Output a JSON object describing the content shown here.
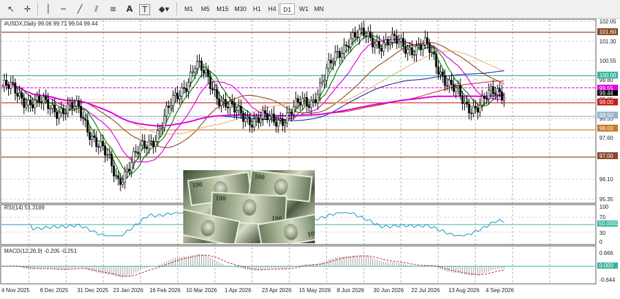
{
  "toolbar": {
    "icons": [
      "cursor-icon",
      "crosshair-icon",
      "vertical-line-icon",
      "horizontal-line-icon",
      "trendline-icon",
      "equidistant-channel-icon",
      "fibonacci-icon",
      "text-icon",
      "text-label-icon",
      "shapes-icon"
    ],
    "timeframes": [
      "M1",
      "M5",
      "M15",
      "M30",
      "H1",
      "H4",
      "D1",
      "W1",
      "MN"
    ],
    "active_timeframe": "D1"
  },
  "symbol_header": "#USDX,Daily  99.06 99.71 99.04 99.44",
  "price_axis": [
    "102.05",
    "101.30",
    "100.55",
    "99.80",
    "99.05",
    "98.35",
    "97.60",
    "96.85",
    "96.10",
    "95.35"
  ],
  "level_labels": {
    "l101_60": "101.60",
    "l100_00": "100.00",
    "l99_55": "99.55",
    "l99_44": "99.44",
    "l99_00": "99.00",
    "l98_50": "98.50",
    "l98_00": "98.00",
    "l97_00": "97.00"
  },
  "colors": {
    "up": "#000000",
    "down": "#000000",
    "ma_green": "#1aa31a",
    "ma_darkgreen": "#0a6e0a",
    "ma_magenta": "#e000e0",
    "ma_brown": "#8b4513",
    "ma_tan": "#e0b060",
    "ma_blue": "#1010a0",
    "ma_red": "#c81e1e",
    "rsi": "#1e90c8",
    "macd_line": "#c81e1e",
    "macd_hist": "#a0a0a0",
    "teal": "#3cb4a0",
    "brown_level": "#8b4a2a"
  },
  "rsi": {
    "label": "RSI(14) 51.3189",
    "axis": [
      "100",
      "70",
      "50.0000",
      "30",
      "0"
    ]
  },
  "macd": {
    "label": "MACD(12,26,9) -0.205 -0.251",
    "axis": [
      "0.666",
      "0.000",
      "-0.644"
    ]
  },
  "date_axis": [
    "4 Nov 2025",
    "8 Dec 2025",
    "31 Dec 2025",
    "23 Jan 2026",
    "16 Feb 2026",
    "10 Mar 2026",
    "1 Apr 2026",
    "23 Apr 2026",
    "15 May 2026",
    "8 Jun 2026",
    "30 Jun 2026",
    "22 Jul 2026",
    "13 Aug 2026",
    "4 Sep 2026"
  ],
  "chart_data": {
    "type": "line",
    "title": "#USDX,Daily",
    "ohlc_last": {
      "open": 99.06,
      "high": 99.71,
      "low": 99.04,
      "close": 99.44
    },
    "x": [
      "4 Nov 2025",
      "8 Dec 2025",
      "31 Dec 2025",
      "23 Jan 2026",
      "16 Feb 2026",
      "10 Mar 2026",
      "1 Apr 2026",
      "23 Apr 2026",
      "15 May 2026",
      "8 Jun 2026",
      "30 Jun 2026",
      "22 Jul 2026",
      "13 Aug 2026",
      "4 Sep 2026"
    ],
    "series": [
      {
        "values": [
          99.6,
          98.9,
          98.7,
          96.2,
          97.9,
          100.4,
          98.6,
          98.3,
          99.1,
          101.5,
          101.2,
          101.0,
          98.8,
          99.44
        ]
      }
    ],
    "ylim": [
      95.35,
      102.05
    ],
    "levels": [
      101.6,
      100.0,
      99.55,
      99.0,
      98.5,
      98.0,
      97.0
    ],
    "rsi_last": 51.3189,
    "macd_last": [
      -0.205,
      -0.251
    ],
    "grid": true
  }
}
